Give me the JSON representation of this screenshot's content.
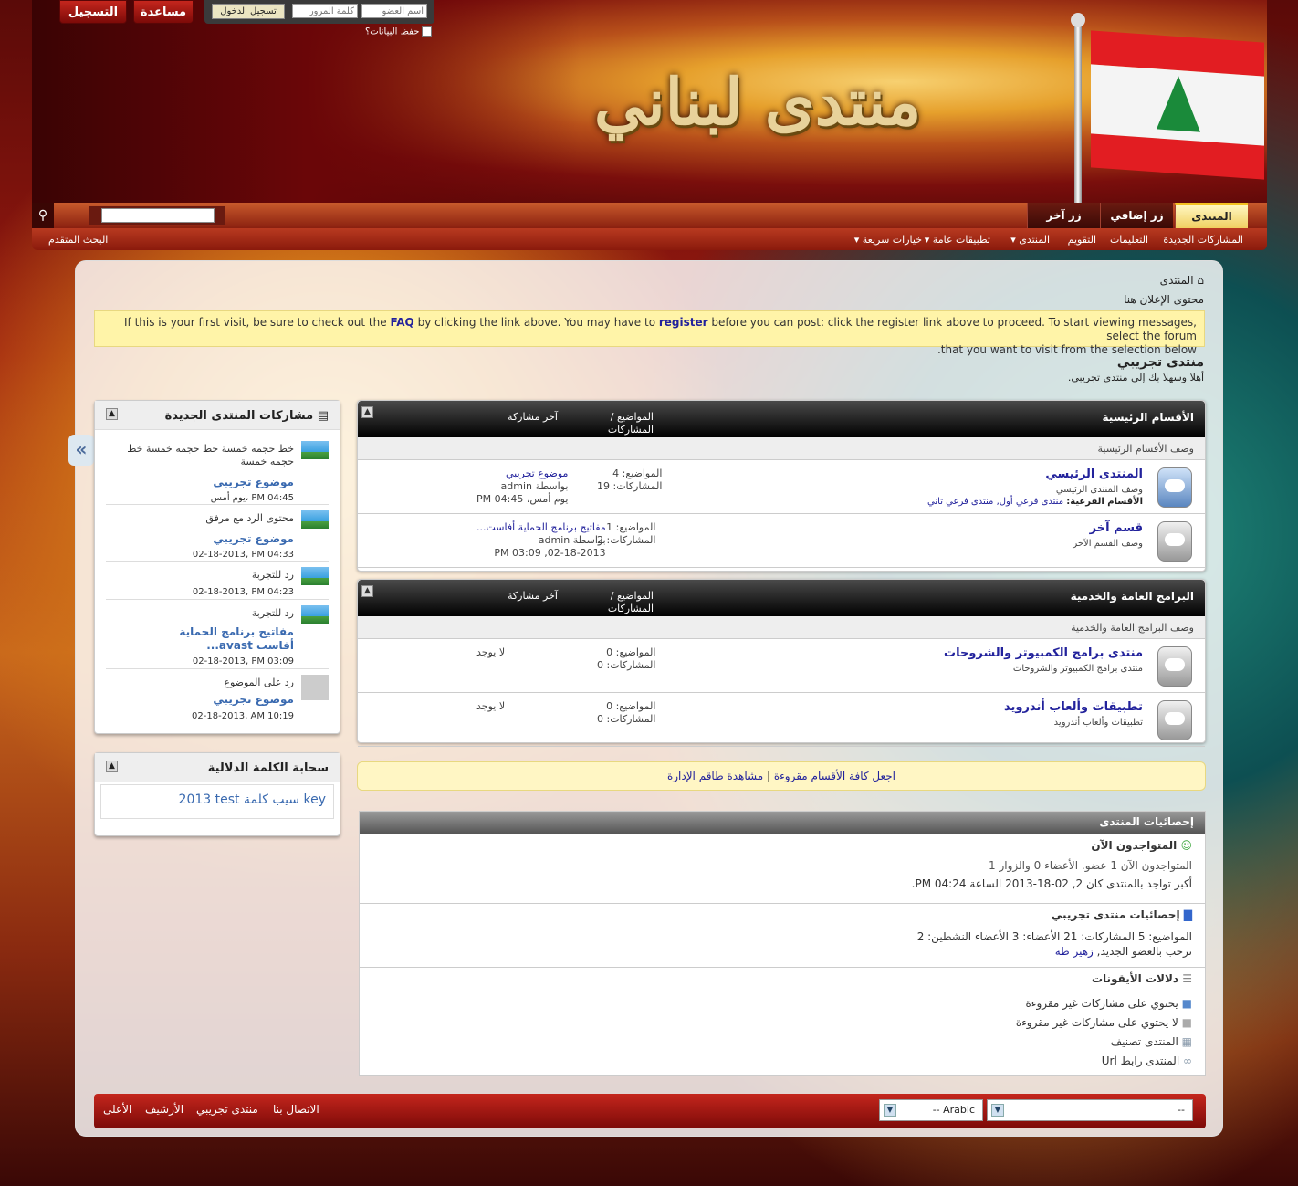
{
  "header": {
    "logo_text": "منتدى لبناني",
    "top_buttons": {
      "register": "التسجيل",
      "help": "مساعدة"
    },
    "login": {
      "username_placeholder": "اسم العضو",
      "password_placeholder": "كلمة المرور",
      "login_button": "تسجيل الدخول",
      "remember": "حفظ البيانات؟"
    }
  },
  "nav": {
    "tabs": [
      "المنتدى",
      "زر إضافي",
      "زر آخر"
    ],
    "active_tab": "المنتدى",
    "sub_items": [
      "المشاركات الجديدة",
      "التعليمات",
      "التقويم",
      "المنتدى ▾",
      "تطبيقات عامة ▾",
      "خيارات سريعة ▾"
    ],
    "advanced_search": "البحث المتقدم",
    "search_icon": "search-icon"
  },
  "main": {
    "breadcrumb": "المنتدى",
    "ad_text": "محتوى الإعلان هنا",
    "notice": {
      "p1": "If this is your first visit, be sure to check out the ",
      "faq": "FAQ",
      "p2": " by clicking the link above. You may have to ",
      "register": "register",
      "p3": " before you can post: click the register link above to proceed. To start viewing messages, select the forum",
      "line2": ".that you want to visit from the selection below"
    },
    "forum_title": "منتدى تجريبي",
    "forum_welcome": "أهلا وسهلا بك إلى منتدى تجريبي."
  },
  "blocks": [
    {
      "title": "الأقسام الرئيسية",
      "col_threads": "المواضيع / المشاركات",
      "col_last": "آخر مشاركة",
      "desc": "وصف الأقسام الرئيسية",
      "rows": [
        {
          "name": "المنتدى الرئيسي",
          "desc": "وصف المنتدى الرئيسي",
          "sub_label": "الأقسام الفرعية:",
          "sub": "منتدى فرعي أول, منتدى فرعي ثاني",
          "threads": "المواضيع: 4",
          "posts": "المشاركات: 19",
          "last_title": "موضوع تجريبي",
          "last_by": "بواسطة admin",
          "last_date": "يوم أمس، PM 04:45"
        },
        {
          "name": "قسم آخر",
          "desc": "وصف القسم الآخر",
          "threads": "المواضيع: 1",
          "posts": "المشاركات: 2",
          "last_title": "مفاتيح برنامج الحماية أفاست...",
          "last_by": "بواسطة admin",
          "last_date": "02-18-2013, PM 03:09"
        }
      ]
    },
    {
      "title": "البرامج العامة والخدمية",
      "col_threads": "المواضيع / المشاركات",
      "col_last": "آخر مشاركة",
      "desc": "وصف البرامج العامة والخدمية",
      "rows": [
        {
          "name": "منتدى برامج الكمبيوتر والشروحات",
          "desc": "منتدى برامج الكمبيوتر والشروحات",
          "threads": "المواضيع: 0",
          "posts": "المشاركات: 0",
          "last_title": "لا يوجد"
        },
        {
          "name": "تطبيقات وألعاب أندرويد",
          "desc": "تطبيقات وألعاب أندرويد",
          "threads": "المواضيع: 0",
          "posts": "المشاركات: 0",
          "last_title": "لا يوجد"
        }
      ]
    }
  ],
  "markbar": {
    "mark_read": "اجعل كافة الأقسام مقروءة",
    "view_staff": "مشاهدة طاقم الإدارة",
    "sep": "|"
  },
  "stats": {
    "title": "إحصائيات المنتدى",
    "online_title": "المتواجدون الآن",
    "online_line": "المتواجدون الآن 1 عضو. الأعضاء 0 والزوار 1",
    "online_max": "أكبر تواجد بالمنتدى كان 2, 02-18-2013 الساعة PM 04:24.",
    "forum_stats_title": "إحصائيات منتدى تجريبي",
    "forum_stats_line": "المواضيع: 5   المشاركات: 21   الأعضاء: 3   الأعضاء النشطين: 2",
    "welcome_new": "نرحب بالعضو الجديد, ",
    "new_member": "زهير طه",
    "icons_title": "دلالات الأيقونات",
    "icons": [
      "يحتوي على مشاركات غير مقروءة",
      "لا يحتوي على مشاركات غير مقروءة",
      "المنتدى تصنيف",
      "المنتدى رابط Url"
    ]
  },
  "sidebar": {
    "new_posts_title": "مشاركات المنتدى الجديدة",
    "posts": [
      {
        "text": "خط حجمه خمسة خط حجمه خمسة خط حجمه خمسة",
        "title": "موضوع تجريبي",
        "date": "يوم أمس، PM 04:45"
      },
      {
        "text": "محتوى الرد مع مرفق",
        "title": "موضوع تجريبي",
        "date": "02-18-2013, PM 04:33"
      },
      {
        "text": "رد للتجربة",
        "title": "",
        "date": "02-18-2013, PM 04:23"
      },
      {
        "text": "رد للتجربة",
        "title": "مفاتيح برنامج الحماية أفاست avast...",
        "date": "02-18-2013, PM 03:09"
      },
      {
        "text": "رد على الموضوع",
        "title": "موضوع تجريبي",
        "date": "02-18-2013, AM 10:19"
      }
    ],
    "tag_cloud_title": "سحابة الكلمة الدلالية",
    "tags": "2013 test سيب كلمة key"
  },
  "footer": {
    "select1": "--",
    "select2": "Arabic --",
    "links": [
      "الاتصال بنا",
      "منتدى تجريبي",
      "الأرشيف",
      "الأعلى"
    ]
  }
}
